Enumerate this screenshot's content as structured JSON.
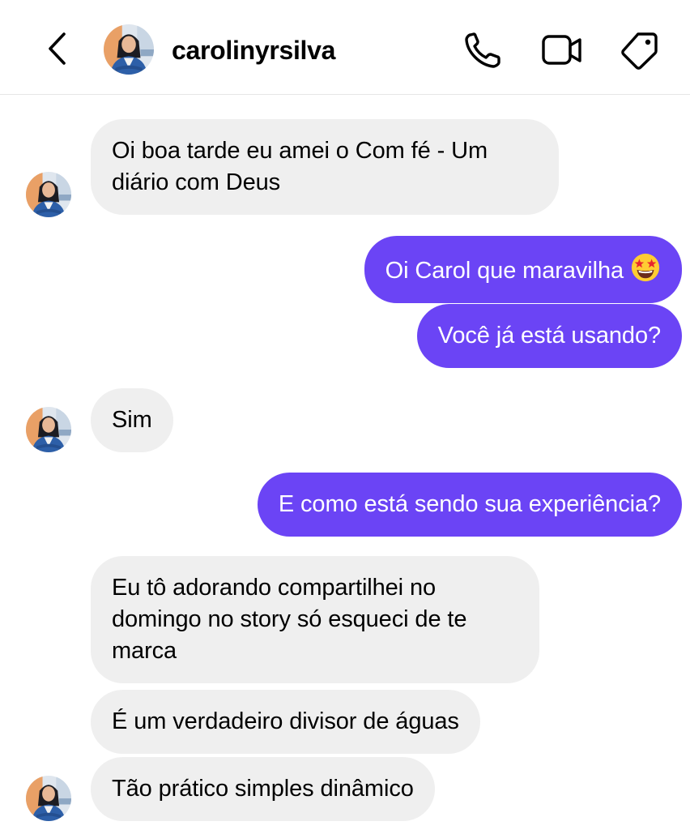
{
  "header": {
    "username": "carolinyrsilva",
    "back_icon": "chevron-left-icon",
    "call_icon": "phone-icon",
    "video_icon": "video-camera-icon",
    "tag_icon": "tag-icon"
  },
  "colors": {
    "outgoing_bubble": "#6b44f5",
    "incoming_bubble": "#efefef"
  },
  "messages": [
    {
      "sender": "them",
      "text": "Oi boa tarde eu amei o Com fé - Um diário com Deus"
    },
    {
      "sender": "me",
      "text": "Oi Carol que maravilha",
      "emoji": "star-struck-emoji"
    },
    {
      "sender": "me",
      "text": "Você já está usando?"
    },
    {
      "sender": "them",
      "text": "Sim"
    },
    {
      "sender": "me",
      "text": "E como está sendo sua experiência?"
    },
    {
      "sender": "them",
      "text": "Eu tô adorando compartilhei no domingo no story só esqueci de te marca"
    },
    {
      "sender": "them",
      "text": "É um verdadeiro divisor de águas"
    },
    {
      "sender": "them",
      "text": "Tão prático simples dinâmico"
    }
  ]
}
